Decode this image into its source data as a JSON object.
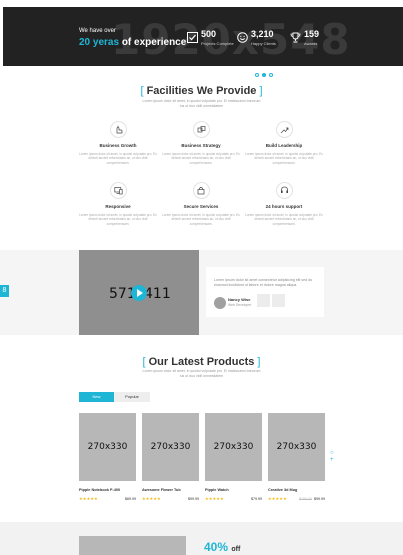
{
  "hero": {
    "watermark": "1920x548",
    "intro": "We have over",
    "headline_accent": "20 yeras",
    "headline_rest": "of experience",
    "stats": [
      {
        "icon": "checkbox-icon",
        "value": "500",
        "label": "Projects Complete"
      },
      {
        "icon": "smile-icon",
        "value": "3,210",
        "label": "Happy Clients"
      },
      {
        "icon": "trophy-icon",
        "value": "159",
        "label": "Awards"
      }
    ]
  },
  "facilities": {
    "title": "Facilities We Provide",
    "subtitle": "Lorem ipsum dolor sit amet, in quodsi vulputate pro. Ei malesuansi bonorum ius ut duo vidit omnesitatem",
    "items": [
      {
        "icon": "hand-pointer-icon",
        "title": "Business Growth",
        "desc": "Lorem ipsum dolor sit amet, in quodsi vulputate pro. Ex delecti ancent reformidans an, ut duo vidit comprehensam."
      },
      {
        "icon": "handshake-icon",
        "title": "Business Strategy",
        "desc": "Lorem ipsum dolor sit amet, in quodsi vulputate pro. Ex delecti ancent reformidans an, ut duo vidit comprehensam."
      },
      {
        "icon": "growth-icon",
        "title": "Build Leadership",
        "desc": "Lorem ipsum dolor sit amet, in quodsi vulputate pro. Ex delecti ancent reformidans an, ut duo vidit comprehensam."
      },
      {
        "icon": "responsive-icon",
        "title": "Responsive",
        "desc": "Lorem ipsum dolor sit amet, in quodsi vulputate pro. Ex delecti ancent reformidans an, ut duo vidit comprehensam."
      },
      {
        "icon": "secure-icon",
        "title": "Secure Services",
        "desc": "Lorem ipsum dolor sit amet, in quodsi vulputate pro. Ex delecti ancent reformidans an, ut duo vidit comprehensam."
      },
      {
        "icon": "support-icon",
        "title": "24 hours support",
        "desc": "Lorem ipsum dolor sit amet, in quodsi vulputate pro. Ex delecti ancent reformidans an, ut duo vidit comprehensam."
      }
    ]
  },
  "video": {
    "placeholder": "571x411"
  },
  "testimonial": {
    "quote": "Lorem ipsum dolor sit amet consectetur adipisicing elit sed do eiusmod incididunt ut labore et dolore magna aliqua.",
    "author": "Nancy Wise",
    "role": "Web Developer"
  },
  "side_tab": {
    "label": "8"
  },
  "products": {
    "title": "Our Latest Products",
    "subtitle": "Lorem ipsum dolor sit amet, in quodsi vulputate pro. Ei malesuansi bonorum ius ut duo vidit omnesitatem",
    "tabs": [
      "New",
      "Popular"
    ],
    "items": [
      {
        "image": "270x330",
        "name": "Pipple Notebook P-400",
        "stars": "★★★★★",
        "old_price": "",
        "price": "$69.99"
      },
      {
        "image": "270x330",
        "name": "Awesome Flower Tub",
        "stars": "★★★★★",
        "old_price": "",
        "price": "$99.99"
      },
      {
        "image": "270x330",
        "name": "Pipple Watch",
        "stars": "★★★★★",
        "old_price": "",
        "price": "$79.99"
      },
      {
        "image": "270x330",
        "name": "Creative 3d Mug",
        "stars": "★★★★★",
        "old_price": "$150.00",
        "price": "$99.99"
      }
    ]
  },
  "promo": {
    "percent": "40%",
    "suffix": "off"
  },
  "colors": {
    "accent": "#1fb6d5",
    "dark": "#222222",
    "placeholder": "#b7b7b7",
    "star": "#f6b600"
  }
}
